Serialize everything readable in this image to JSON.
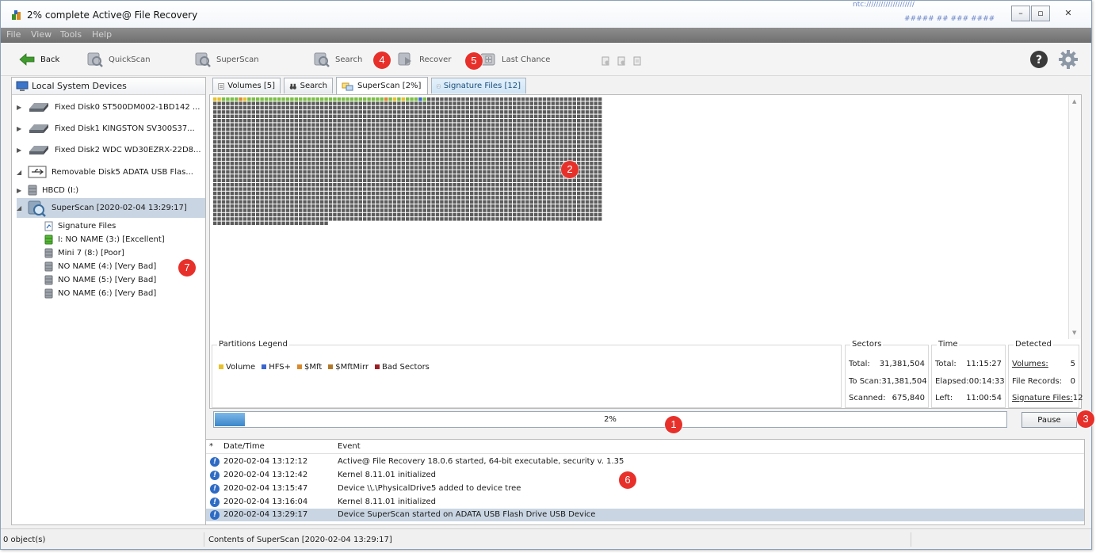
{
  "window": {
    "title": "2% complete Active@ File Recovery",
    "background_text_1": "ntc:////////////////////",
    "background_text_2": "##### ## ### ####",
    "minimize": "–",
    "maximize": "▫",
    "close": "✕"
  },
  "menu": [
    "File",
    "View",
    "Tools",
    "Help"
  ],
  "toolbar": {
    "back": "Back",
    "quickscan": "QuickScan",
    "superscan": "SuperScan",
    "search": "Search",
    "recover": "Recover",
    "last_chance": "Last Chance"
  },
  "badges": [
    "1",
    "2",
    "3",
    "4",
    "5",
    "6",
    "7"
  ],
  "left_panel": {
    "header": "Local System Devices",
    "devices": [
      "Fixed Disk0 ST500DM002-1BD142 ...",
      "Fixed Disk1 KINGSTON SV300S37...",
      "Fixed Disk2 WDC WD30EZRX-22D8...",
      "Removable Disk5 ADATA USB Flas..."
    ],
    "partition": "HBCD (I:)",
    "superscan_node": "SuperScan [2020-02-04 13:29:17]",
    "children": [
      "Signature Files",
      "I: NO NAME (3:) [Excellent]",
      "Mini 7 (8:) [Poor]",
      "NO NAME (4:) [Very Bad]",
      "NO NAME (5:) [Very Bad]",
      "NO NAME (6:) [Very Bad]"
    ]
  },
  "tabs": {
    "volumes": "Volumes [5]",
    "search": "Search",
    "superscan": "SuperScan [2%]",
    "signature": "Signature Files [12]"
  },
  "scan_map": {
    "cols": 91,
    "full_rows": 29,
    "last_row_cells": 27,
    "progress_fraction": 0.02
  },
  "legend": {
    "title": "Partitions Legend",
    "items": [
      {
        "label": "Volume",
        "color": "#e8c128"
      },
      {
        "label": "HFS+",
        "color": "#3a66d0"
      },
      {
        "label": "$Mft",
        "color": "#d98a2e"
      },
      {
        "label": "$MftMirr",
        "color": "#b2792b"
      },
      {
        "label": "Bad Sectors",
        "color": "#9c1f26"
      }
    ]
  },
  "sectors": {
    "title": "Sectors",
    "total_label": "Total:",
    "total": "31,381,504",
    "toscan_label": "To Scan:",
    "toscan": "31,381,504",
    "scanned_label": "Scanned:",
    "scanned": "675,840"
  },
  "time": {
    "title": "Time",
    "total_label": "Total:",
    "total": "11:15:27",
    "elapsed_label": "Elapsed:",
    "elapsed": "00:14:33",
    "left_label": "Left:",
    "left": "11:00:54"
  },
  "detected": {
    "title": "Detected",
    "volumes_label": "Volumes:",
    "volumes": "5",
    "records_label": "File Records:",
    "records": "0",
    "signature_label": "Signature Files:",
    "signature": "12"
  },
  "progress": {
    "text": "2%",
    "value": 0.02
  },
  "pause_label": "Pause",
  "log": {
    "col_star": "*",
    "col_date": "Date/Time",
    "col_event": "Event",
    "rows": [
      {
        "date": "2020-02-04 13:12:12",
        "event": "Active@ File Recovery 18.0.6 started, 64-bit executable, security v. 1.35"
      },
      {
        "date": "2020-02-04 13:12:42",
        "event": "Kernel 8.11.01 initialized"
      },
      {
        "date": "2020-02-04 13:15:47",
        "event": "Device \\\\.\\PhysicalDrive5 added to device tree"
      },
      {
        "date": "2020-02-04 13:16:04",
        "event": "Kernel 8.11.01 initialized"
      },
      {
        "date": "2020-02-04 13:29:17",
        "event": "Device SuperScan started on ADATA USB Flash Drive USB Device"
      }
    ]
  },
  "status": {
    "left": "0 object(s)",
    "right": "Contents of SuperScan [2020-02-04 13:29:17]"
  },
  "colors": {
    "selection": "#c9d5e2",
    "cell_empty": "#5c5c5c",
    "cell_scanned": "#7bc043",
    "badge": "#e8302a",
    "progress": "#3a86c9"
  }
}
